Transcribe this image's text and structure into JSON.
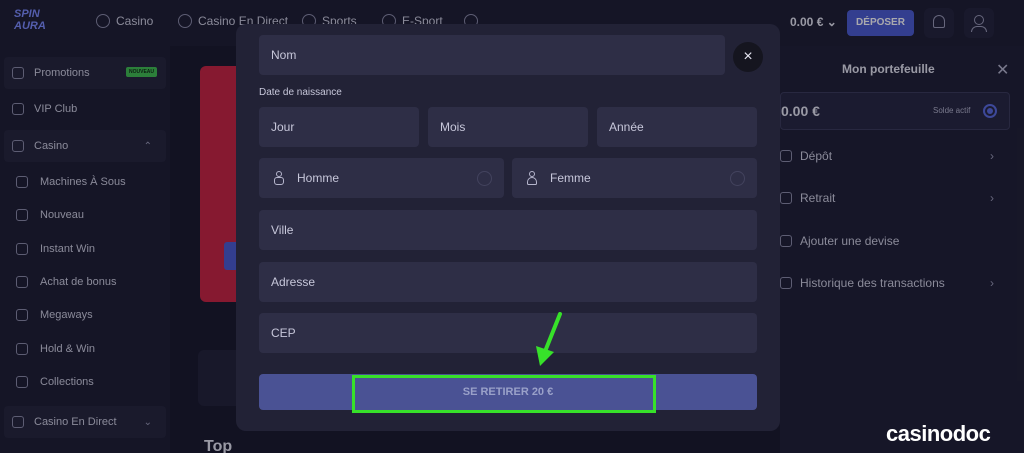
{
  "header": {
    "logo_line1": "SPIN",
    "logo_line2": "AURA",
    "nav": [
      "Casino",
      "Casino En Direct",
      "Sports",
      "E-Sport"
    ],
    "balance": "0.00 € ⌄",
    "deposit_label": "DÉPOSER"
  },
  "sidebar": {
    "promotions": "Promotions",
    "promotions_badge": "NOUVEAU",
    "vip": "VIP Club",
    "casino": "Casino",
    "sub": [
      "Machines À Sous",
      "Nouveau",
      "Instant Win",
      "Achat de bonus",
      "Megaways",
      "Hold & Win",
      "Collections"
    ],
    "casino_live": "Casino En Direct"
  },
  "main": {
    "top_label": "Top"
  },
  "wallet": {
    "title": "Mon portefeuille",
    "balance": "0.00 €",
    "balance_label": "Solde actif",
    "rows": [
      "Dépôt",
      "Retrait",
      "Ajouter une devise",
      "Historique des transactions"
    ]
  },
  "form": {
    "nom_placeholder": "Nom",
    "dob_label": "Date de naissance",
    "jour": "Jour",
    "mois": "Mois",
    "annee": "Année",
    "homme": "Homme",
    "femme": "Femme",
    "ville": "Ville",
    "adresse": "Adresse",
    "cep": "CEP",
    "submit_label": "SE RETIRER 20 €"
  },
  "watermark": "casinodoc",
  "colors": {
    "accent": "#4a5bd1",
    "highlight": "#37e12a",
    "promo": "#c9223f"
  }
}
